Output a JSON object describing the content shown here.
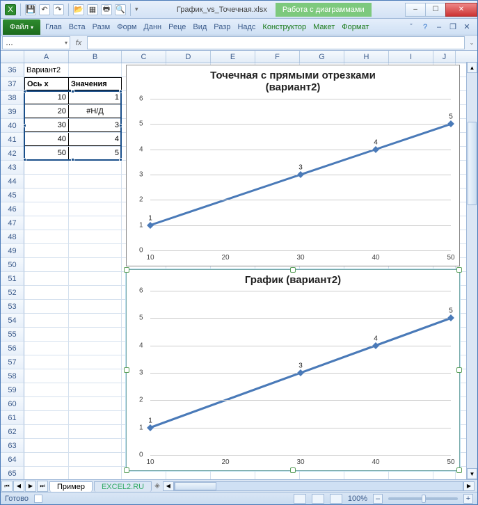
{
  "window": {
    "filename": "График_vs_Точечная.xlsx",
    "context_tab": "Работа с диаграммами",
    "min": "–",
    "max": "☐",
    "close": "✕"
  },
  "ribbon": {
    "file": "Файл",
    "tabs": [
      "Глав",
      "Вста",
      "Разм",
      "Форм",
      "Данн",
      "Реце",
      "Вид",
      "Разр",
      "Надс"
    ],
    "ctx_tabs": [
      "Конструктор",
      "Макет",
      "Формат"
    ]
  },
  "namebox": "…",
  "fx": "fx",
  "columns": [
    "A",
    "B",
    "C",
    "D",
    "E",
    "F",
    "G",
    "H",
    "I",
    "J"
  ],
  "row_start": 36,
  "row_end": 65,
  "table": {
    "variant": "Вариант2",
    "h1": "Ось х",
    "h2": "Значения",
    "rows": [
      {
        "x": "10",
        "y": "1"
      },
      {
        "x": "20",
        "y": "#Н/Д"
      },
      {
        "x": "30",
        "y": "3"
      },
      {
        "x": "40",
        "y": "4"
      },
      {
        "x": "50",
        "y": "5"
      }
    ]
  },
  "chart_data": [
    {
      "type": "scatter-line",
      "title": "Точечная с прямыми отрезками (вариант2)",
      "x": [
        10,
        20,
        30,
        40,
        50
      ],
      "y": [
        1,
        null,
        3,
        4,
        5
      ],
      "data_labels": [
        "1",
        "",
        "3",
        "4",
        "5"
      ],
      "xlim": [
        10,
        50
      ],
      "ylim": [
        0,
        6
      ],
      "xticks": [
        10,
        20,
        30,
        40,
        50
      ],
      "yticks": [
        0,
        1,
        2,
        3,
        4,
        5,
        6
      ]
    },
    {
      "type": "line",
      "title": "График (вариант2)",
      "categories": [
        "10",
        "20",
        "30",
        "40",
        "50"
      ],
      "values": [
        1,
        null,
        3,
        4,
        5
      ],
      "data_labels": [
        "1",
        "",
        "3",
        "4",
        "5"
      ],
      "ylim": [
        0,
        6
      ],
      "yticks": [
        0,
        1,
        2,
        3,
        4,
        5,
        6
      ]
    }
  ],
  "sheets": {
    "active": "Пример",
    "inactive": "EXCEL2.RU"
  },
  "status": {
    "ready": "Готово",
    "zoom": "100%",
    "minus": "–",
    "plus": "+"
  }
}
